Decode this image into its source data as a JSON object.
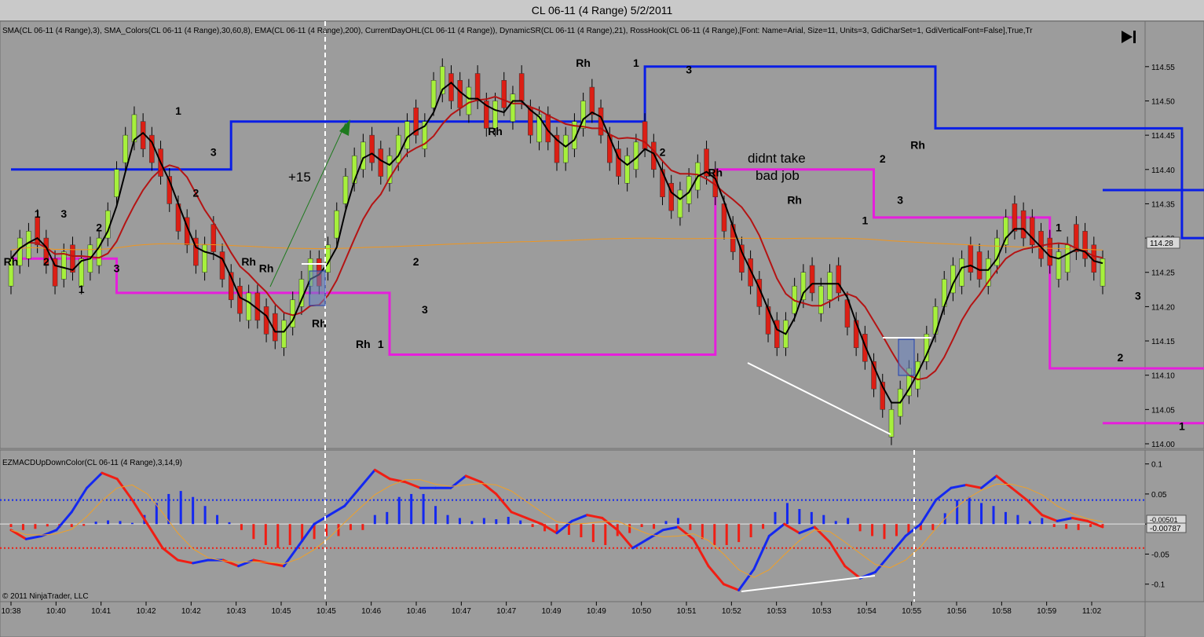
{
  "window": {
    "title": "CL 06-11 (4 Range)  5/2/2011"
  },
  "price_panel": {
    "indicator_label": "SMA(CL 06-11 (4 Range),3), SMA_Colors(CL 06-11 (4 Range),30,60,8), EMA(CL 06-11 (4 Range),200), CurrentDayOHL(CL 06-11 (4 Range)), DynamicSR(CL 06-11 (4 Range),21), RossHook(CL 06-11 (4 Range),[Font: Name=Arial, Size=11, Units=3, GdiCharSet=1, GdiVerticalFont=False],True,Tr",
    "last_price": "114.28",
    "annotations": {
      "plus15": "+15",
      "comment_line1": "didnt take",
      "comment_line2": "bad job"
    }
  },
  "macd_panel": {
    "label": "EZMACDUpDownColor(CL 06-11 (4 Range),3,14,9)",
    "value_a": "-0.00501",
    "value_b": "-0.00787",
    "copyright": "© 2011 NinjaTrader, LLC"
  },
  "colors": {
    "blue_level": "#0a1ee6",
    "magenta_level": "#e61edc",
    "up_bar": "#a6f03c",
    "down_bar": "#dc1e14",
    "macd_up": "#1428f0",
    "macd_down": "#f01e14"
  },
  "chart_data": [
    {
      "type": "candlestick",
      "panel": "price",
      "ylim": [
        114.0,
        114.575
      ],
      "y_ticks": [
        "114.55",
        "114.50",
        "114.45",
        "114.40",
        "114.35",
        "114.30",
        "114.25",
        "114.20",
        "114.15",
        "114.10",
        "114.05",
        "114.00"
      ],
      "x_tick_labels": [
        "10:38",
        "10:40",
        "10:41",
        "10:42",
        "10:42",
        "10:43",
        "10:45",
        "10:45",
        "10:46",
        "10:46",
        "10:47",
        "10:47",
        "10:49",
        "10:49",
        "10:50",
        "10:51",
        "10:52",
        "10:53",
        "10:53",
        "10:54",
        "10:55",
        "10:56",
        "10:58",
        "10:59",
        "11:02"
      ],
      "close": [
        114.27,
        114.3,
        114.31,
        114.29,
        114.26,
        114.23,
        114.28,
        114.25,
        114.27,
        114.29,
        114.3,
        114.34,
        114.4,
        114.45,
        114.48,
        114.43,
        114.41,
        114.39,
        114.35,
        114.31,
        114.29,
        114.26,
        114.29,
        114.28,
        114.24,
        114.21,
        114.19,
        114.22,
        114.18,
        114.16,
        114.15,
        114.18,
        114.21,
        114.24,
        114.27,
        114.23,
        114.29,
        114.34,
        114.39,
        114.42,
        114.44,
        114.41,
        114.39,
        114.42,
        114.45,
        114.47,
        114.45,
        114.47,
        114.53,
        114.55,
        114.5,
        114.49,
        114.52,
        114.5,
        114.46,
        114.5,
        114.49,
        114.51,
        114.5,
        114.45,
        114.48,
        114.44,
        114.41,
        114.45,
        114.47,
        114.5,
        114.48,
        114.45,
        114.41,
        114.39,
        114.42,
        114.44,
        114.43,
        114.4,
        114.36,
        114.34,
        114.37,
        114.39,
        114.41,
        114.39,
        114.36,
        114.31,
        114.28,
        114.25,
        114.23,
        114.2,
        114.16,
        114.14,
        114.18,
        114.23,
        114.25,
        114.22,
        114.23,
        114.25,
        114.22,
        114.17,
        114.14,
        114.12,
        114.08,
        114.05,
        114.05,
        114.08,
        114.11,
        114.12,
        114.16,
        114.2,
        114.24,
        114.26,
        114.27,
        114.25,
        114.24,
        114.27,
        114.3,
        114.33,
        114.31,
        114.3,
        114.29,
        114.27,
        114.26,
        114.28,
        114.29,
        114.28,
        114.27,
        114.25,
        114.27
      ],
      "candle_width_units": 3,
      "overlays": [
        {
          "name": "SMA(3)",
          "color": "#000000"
        },
        {
          "name": "SMA_Colors(30,60,8)",
          "color": "#b41414"
        },
        {
          "name": "EMA(200)",
          "color": "#f0961e"
        },
        {
          "name": "DynamicSR upper",
          "color": "#0a1ee6",
          "steps": [
            [
              0,
              114.4
            ],
            [
              25,
              114.47
            ],
            [
              72,
              114.55
            ],
            [
              105,
              114.46
            ],
            [
              133,
              114.3
            ],
            [
              160,
              114.37
            ]
          ]
        },
        {
          "name": "DynamicSR lower",
          "color": "#e61edc",
          "steps": [
            [
              0,
              114.27
            ],
            [
              12,
              114.22
            ],
            [
              43,
              114.13
            ],
            [
              80,
              114.4
            ],
            [
              98,
              114.33
            ],
            [
              118,
              114.11
            ],
            [
              138,
              114.03
            ]
          ]
        }
      ],
      "hook_labels": [
        {
          "t": "Rh",
          "i": 0,
          "p": 114.26
        },
        {
          "t": "1",
          "i": 3,
          "p": 114.33
        },
        {
          "t": "3",
          "i": 6,
          "p": 114.33
        },
        {
          "t": "2",
          "i": 4,
          "p": 114.26
        },
        {
          "t": "1",
          "i": 8,
          "p": 114.22
        },
        {
          "t": "2",
          "i": 10,
          "p": 114.31
        },
        {
          "t": "3",
          "i": 12,
          "p": 114.25
        },
        {
          "t": "1",
          "i": 19,
          "p": 114.48
        },
        {
          "t": "3",
          "i": 23,
          "p": 114.42
        },
        {
          "t": "2",
          "i": 21,
          "p": 114.36
        },
        {
          "t": "Rh",
          "i": 27,
          "p": 114.26
        },
        {
          "t": "Rh",
          "i": 29,
          "p": 114.25
        },
        {
          "t": "Rh",
          "i": 35,
          "p": 114.17
        },
        {
          "t": "Rh",
          "i": 40,
          "p": 114.14
        },
        {
          "t": "1",
          "i": 42,
          "p": 114.14
        },
        {
          "t": "2",
          "i": 46,
          "p": 114.26
        },
        {
          "t": "3",
          "i": 47,
          "p": 114.19
        },
        {
          "t": "Rh",
          "i": 55,
          "p": 114.45
        },
        {
          "t": "Rh",
          "i": 65,
          "p": 114.55
        },
        {
          "t": "1",
          "i": 71,
          "p": 114.55
        },
        {
          "t": "3",
          "i": 77,
          "p": 114.54
        },
        {
          "t": "2",
          "i": 74,
          "p": 114.42
        },
        {
          "t": "Rh",
          "i": 80,
          "p": 114.39
        },
        {
          "t": "Rh",
          "i": 89,
          "p": 114.35
        },
        {
          "t": "2",
          "i": 99,
          "p": 114.41
        },
        {
          "t": "Rh",
          "i": 103,
          "p": 114.43
        },
        {
          "t": "3",
          "i": 101,
          "p": 114.35
        },
        {
          "t": "1",
          "i": 97,
          "p": 114.32
        },
        {
          "t": "1",
          "i": 119,
          "p": 114.31
        },
        {
          "t": "3",
          "i": 128,
          "p": 114.21
        },
        {
          "t": "2",
          "i": 126,
          "p": 114.12
        },
        {
          "t": "1",
          "i": 133,
          "p": 114.02
        },
        {
          "t": "2",
          "i": 137,
          "p": 114.16
        },
        {
          "t": "3",
          "i": 138,
          "p": 114.1
        },
        {
          "t": "Rh",
          "i": 143,
          "p": 114.31
        },
        {
          "t": "1",
          "i": 150,
          "p": 114.38
        },
        {
          "t": "3",
          "i": 154,
          "p": 114.36
        },
        {
          "t": "2",
          "i": 153,
          "p": 114.26
        },
        {
          "t": "2",
          "i": 159,
          "p": 114.31
        },
        {
          "t": "1",
          "i": 158,
          "p": 114.23
        },
        {
          "t": "1",
          "i": 163,
          "p": 114.35
        },
        {
          "t": "3",
          "i": 165,
          "p": 114.33
        },
        {
          "t": "3",
          "i": 160,
          "p": 114.24
        },
        {
          "t": "2",
          "i": 164,
          "p": 114.24
        },
        {
          "t": "Rh",
          "i": 167,
          "p": 114.24
        }
      ]
    },
    {
      "type": "bar+line",
      "panel": "macd",
      "ylim": [
        -0.12,
        0.11
      ],
      "y_ticks": [
        "0.1",
        "0.05",
        "0",
        "-0.05",
        "-0.1"
      ],
      "reference_lines": [
        0.04,
        -0.04
      ],
      "histogram": [
        -0.005,
        -0.01,
        -0.008,
        -0.004,
        -0.006,
        -0.005,
        -0.003,
        0.004,
        0.006,
        0.005,
        0.002,
        0.015,
        0.035,
        0.05,
        0.055,
        0.045,
        0.03,
        0.015,
        0.003,
        -0.01,
        -0.025,
        -0.035,
        -0.04,
        -0.035,
        -0.03,
        -0.025,
        -0.02,
        -0.02,
        -0.01,
        -0.01,
        0.015,
        0.02,
        0.045,
        0.05,
        0.05,
        0.03,
        0.015,
        0.01,
        0.005,
        0.01,
        0.008,
        0.012,
        0.006,
        -0.005,
        -0.012,
        -0.015,
        -0.018,
        -0.022,
        -0.03,
        -0.035,
        -0.02,
        -0.015,
        -0.005,
        -0.008,
        0.005,
        0.01,
        -0.01,
        -0.025,
        -0.035,
        -0.035,
        -0.03,
        -0.022,
        -0.008,
        0.02,
        0.035,
        0.025,
        0.02,
        0.015,
        0.005,
        0.01,
        -0.012,
        -0.02,
        -0.025,
        -0.02,
        -0.015,
        -0.01,
        -0.01,
        0.018,
        0.04,
        0.045,
        0.035,
        0.03,
        0.02,
        0.015,
        0.005,
        0.01,
        -0.005,
        -0.008,
        -0.01,
        -0.005,
        -0.003
      ],
      "line_values": [
        -0.01,
        -0.025,
        -0.02,
        -0.01,
        0.02,
        0.06,
        0.085,
        0.075,
        0.04,
        0.0,
        -0.04,
        -0.06,
        -0.065,
        -0.06,
        -0.06,
        -0.07,
        -0.06,
        -0.065,
        -0.07,
        -0.035,
        0.0,
        0.015,
        0.03,
        0.06,
        0.09,
        0.075,
        0.07,
        0.06,
        0.06,
        0.06,
        0.08,
        0.07,
        0.05,
        0.02,
        0.01,
        0.0,
        -0.015,
        0.005,
        0.015,
        0.01,
        -0.01,
        -0.04,
        -0.025,
        -0.01,
        -0.005,
        -0.025,
        -0.07,
        -0.1,
        -0.11,
        -0.075,
        -0.02,
        0.0,
        -0.015,
        -0.005,
        -0.03,
        -0.07,
        -0.09,
        -0.08,
        -0.05,
        -0.02,
        0.0,
        0.04,
        0.06,
        0.065,
        0.06,
        0.08,
        0.06,
        0.04,
        0.015,
        0.005,
        0.01,
        0.005,
        -0.005
      ]
    }
  ]
}
